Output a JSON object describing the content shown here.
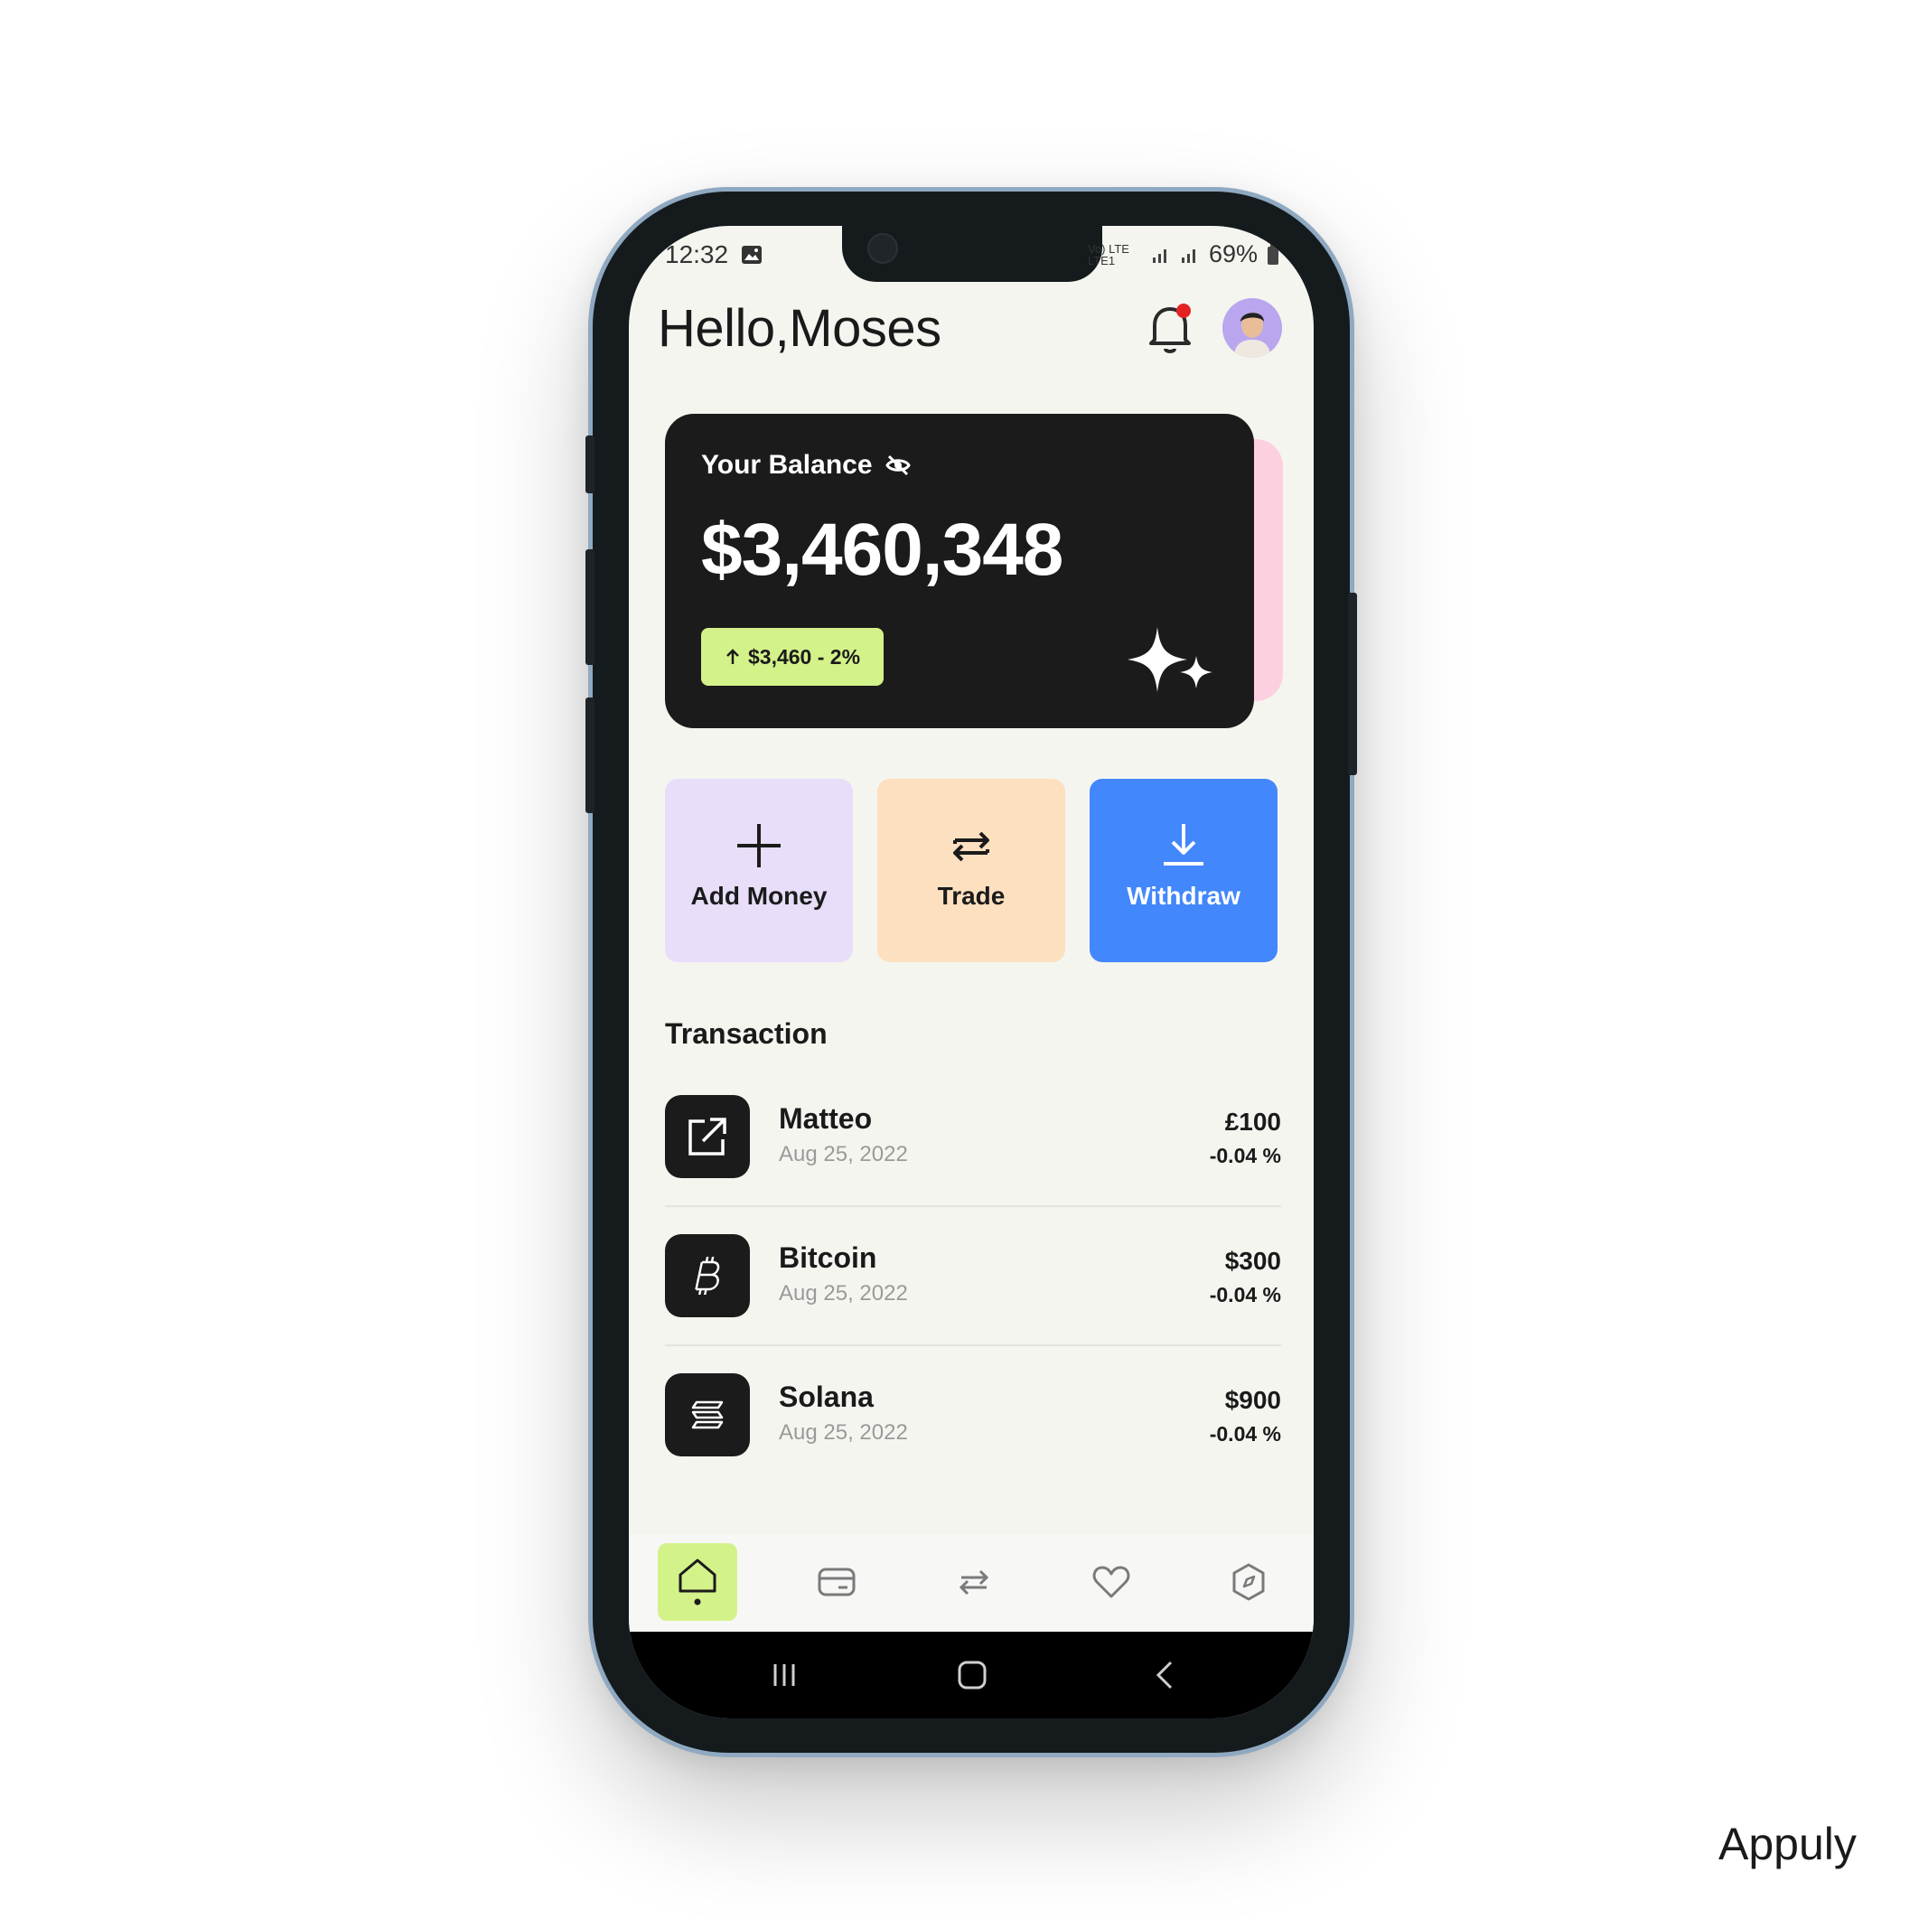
{
  "status_bar": {
    "time": "12:32",
    "network": "Vo) LTE LTE1",
    "battery": "69%"
  },
  "header": {
    "greeting": "Hello,Moses"
  },
  "balance_card": {
    "label": "Your Balance",
    "amount": "$3,460,348",
    "change": "$3,460 - 2%"
  },
  "actions": [
    {
      "label": "Add Money",
      "color": "#e8defa"
    },
    {
      "label": "Trade",
      "color": "#fde0c0"
    },
    {
      "label": "Withdraw",
      "color": "#4287fc"
    }
  ],
  "transactions": {
    "title": "Transaction",
    "items": [
      {
        "name": "Matteo",
        "date": "Aug 25, 2022",
        "amount": "£100",
        "change": "-0.04 %",
        "icon": "external-link-icon"
      },
      {
        "name": "Bitcoin",
        "date": "Aug 25, 2022",
        "amount": "$300",
        "change": "-0.04 %",
        "icon": "bitcoin-icon"
      },
      {
        "name": "Solana",
        "date": "Aug 25, 2022",
        "amount": "$900",
        "change": "-0.04 %",
        "icon": "solana-icon"
      }
    ]
  },
  "bottom_nav": [
    {
      "icon": "home-icon",
      "active": true
    },
    {
      "icon": "card-icon",
      "active": false
    },
    {
      "icon": "swap-icon",
      "active": false
    },
    {
      "icon": "heart-icon",
      "active": false
    },
    {
      "icon": "compass-icon",
      "active": false
    }
  ],
  "watermark": "Appuly",
  "colors": {
    "accent": "#d4f28a",
    "card": "#1b1b1b",
    "notification_dot": "#e52222"
  }
}
